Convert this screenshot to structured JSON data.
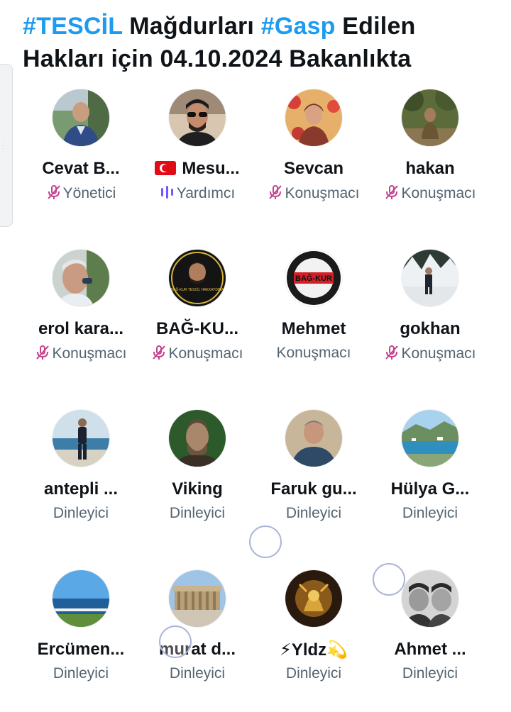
{
  "space": {
    "title_hashtag_1": "#TESCİL",
    "title_text_1": " Mağdurları ",
    "title_hashtag_2": "#Gasp",
    "title_text_2": " Edilen Hakları için 04.10.2024 Bakanlıkta"
  },
  "colors": {
    "accent": "#1d9bf0",
    "muted": "#536471",
    "mute_icon": "#c2418d",
    "speaking_icon": "#7856ff"
  },
  "participants": [
    {
      "name": "Cevat B...",
      "role": "Yönetici",
      "mic": "muted-mic-icon"
    },
    {
      "name": "Mesu...",
      "flag": "turkey-flag",
      "role": "Yardımcı",
      "mic": "speaking-bars-icon"
    },
    {
      "name": "Sevcan",
      "role": "Konuşmacı",
      "mic": "muted-mic-icon"
    },
    {
      "name": "hakan",
      "role": "Konuşmacı",
      "mic": "muted-mic-icon"
    },
    {
      "name": "erol kara...",
      "role": "Konuşmacı",
      "mic": "muted-mic-icon"
    },
    {
      "name": "BAĞ-KU...",
      "role": "Konuşmacı",
      "mic": "muted-mic-icon",
      "avatar_text": "BAĞ-KUR TESCİL HAKKAYDINA"
    },
    {
      "name": "Mehmet",
      "role": "Konuşmacı",
      "avatar_text": "BAĞ-KUR"
    },
    {
      "name": "gokhan",
      "role": "Konuşmacı",
      "mic": "muted-mic-icon"
    },
    {
      "name": "antepli ...",
      "role": "Dinleyici"
    },
    {
      "name": "Viking",
      "role": "Dinleyici"
    },
    {
      "name": "Faruk gu...",
      "role": "Dinleyici"
    },
    {
      "name": "Hülya G...",
      "role": "Dinleyici"
    },
    {
      "name": "Ercümen...",
      "role": "Dinleyici"
    },
    {
      "name": "murat d...",
      "role": "Dinleyici"
    },
    {
      "name": "⚡Yldz💫",
      "role": "Dinleyici"
    },
    {
      "name": "Ahmet ...",
      "role": "Dinleyici"
    }
  ]
}
